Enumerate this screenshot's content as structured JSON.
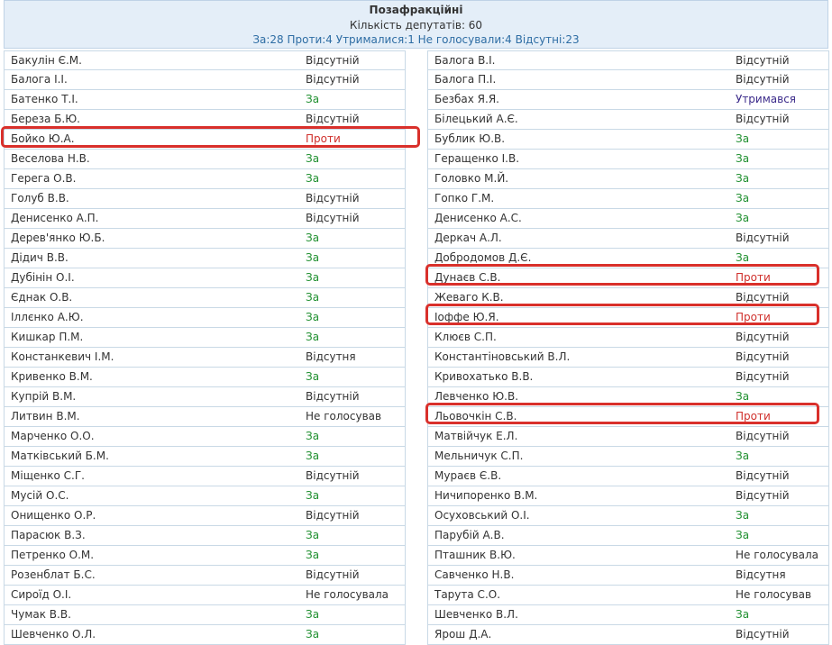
{
  "header": {
    "title": "Позафракційні",
    "count": "Кількість депутатів: 60",
    "summary": "За:28 Проти:4 Утрималися:1 Не голосували:4 Відсутні:23"
  },
  "colors": {
    "za": "#1f8f2f",
    "against": "#d0312d",
    "abstain": "#3b2a8a",
    "highlight": "#d9302b"
  },
  "left": [
    {
      "name": "Бакулін Є.М.",
      "vote": "Відсутній",
      "t": "absent"
    },
    {
      "name": "Балога І.І.",
      "vote": "Відсутній",
      "t": "absent"
    },
    {
      "name": "Батенко Т.І.",
      "vote": "За",
      "t": "za"
    },
    {
      "name": "Береза Б.Ю.",
      "vote": "Відсутній",
      "t": "absent"
    },
    {
      "name": "Бойко Ю.А.",
      "vote": "Проти",
      "t": "against",
      "hl": true
    },
    {
      "name": "Веселова Н.В.",
      "vote": "За",
      "t": "za"
    },
    {
      "name": "Герега О.В.",
      "vote": "За",
      "t": "za"
    },
    {
      "name": "Голуб В.В.",
      "vote": "Відсутній",
      "t": "absent"
    },
    {
      "name": "Денисенко А.П.",
      "vote": "Відсутній",
      "t": "absent"
    },
    {
      "name": "Дерев'янко Ю.Б.",
      "vote": "За",
      "t": "za"
    },
    {
      "name": "Дідич В.В.",
      "vote": "За",
      "t": "za"
    },
    {
      "name": "Дубінін О.І.",
      "vote": "За",
      "t": "za"
    },
    {
      "name": "Єднак О.В.",
      "vote": "За",
      "t": "za"
    },
    {
      "name": "Іллєнко А.Ю.",
      "vote": "За",
      "t": "za"
    },
    {
      "name": "Кишкар П.М.",
      "vote": "За",
      "t": "za"
    },
    {
      "name": "Констанкевич І.М.",
      "vote": "Відсутня",
      "t": "absent"
    },
    {
      "name": "Кривенко В.М.",
      "vote": "За",
      "t": "za"
    },
    {
      "name": "Купрій В.М.",
      "vote": "Відсутній",
      "t": "absent"
    },
    {
      "name": "Литвин В.М.",
      "vote": "Не голосував",
      "t": "nv"
    },
    {
      "name": "Марченко О.О.",
      "vote": "За",
      "t": "za"
    },
    {
      "name": "Матківський Б.М.",
      "vote": "За",
      "t": "za"
    },
    {
      "name": "Міщенко С.Г.",
      "vote": "Відсутній",
      "t": "absent"
    },
    {
      "name": "Мусій О.С.",
      "vote": "За",
      "t": "za"
    },
    {
      "name": "Онищенко О.Р.",
      "vote": "Відсутній",
      "t": "absent"
    },
    {
      "name": "Парасюк В.З.",
      "vote": "За",
      "t": "za"
    },
    {
      "name": "Петренко О.М.",
      "vote": "За",
      "t": "za"
    },
    {
      "name": "Розенблат Б.С.",
      "vote": "Відсутній",
      "t": "absent"
    },
    {
      "name": "Сироїд О.І.",
      "vote": "Не голосувала",
      "t": "nv"
    },
    {
      "name": "Чумак В.В.",
      "vote": "За",
      "t": "za"
    },
    {
      "name": "Шевченко О.Л.",
      "vote": "За",
      "t": "za"
    }
  ],
  "right": [
    {
      "name": "Балога В.І.",
      "vote": "Відсутній",
      "t": "absent"
    },
    {
      "name": "Балога П.І.",
      "vote": "Відсутній",
      "t": "absent"
    },
    {
      "name": "Безбах Я.Я.",
      "vote": "Утримався",
      "t": "abstain"
    },
    {
      "name": "Білецький А.Є.",
      "vote": "Відсутній",
      "t": "absent"
    },
    {
      "name": "Бублик Ю.В.",
      "vote": "За",
      "t": "za"
    },
    {
      "name": "Геращенко І.В.",
      "vote": "За",
      "t": "za"
    },
    {
      "name": "Головко М.Й.",
      "vote": "За",
      "t": "za"
    },
    {
      "name": "Гопко Г.М.",
      "vote": "За",
      "t": "za"
    },
    {
      "name": "Денисенко А.С.",
      "vote": "За",
      "t": "za"
    },
    {
      "name": "Деркач А.Л.",
      "vote": "Відсутній",
      "t": "absent"
    },
    {
      "name": "Добродомов Д.Є.",
      "vote": "За",
      "t": "za"
    },
    {
      "name": "Дунаєв С.В.",
      "vote": "Проти",
      "t": "against",
      "hl": true
    },
    {
      "name": "Жеваго К.В.",
      "vote": "Відсутній",
      "t": "absent"
    },
    {
      "name": "Іоффе Ю.Я.",
      "vote": "Проти",
      "t": "against",
      "hl": true
    },
    {
      "name": "Клюєв С.П.",
      "vote": "Відсутній",
      "t": "absent"
    },
    {
      "name": "Константіновський В.Л.",
      "vote": "Відсутній",
      "t": "absent"
    },
    {
      "name": "Кривохатько В.В.",
      "vote": "Відсутній",
      "t": "absent"
    },
    {
      "name": "Левченко Ю.В.",
      "vote": "За",
      "t": "za"
    },
    {
      "name": "Льовочкін С.В.",
      "vote": "Проти",
      "t": "against",
      "hl": true
    },
    {
      "name": "Матвійчук Е.Л.",
      "vote": "Відсутній",
      "t": "absent"
    },
    {
      "name": "Мельничук С.П.",
      "vote": "За",
      "t": "za"
    },
    {
      "name": "Мураєв Є.В.",
      "vote": "Відсутній",
      "t": "absent"
    },
    {
      "name": "Ничипоренко В.М.",
      "vote": "Відсутній",
      "t": "absent"
    },
    {
      "name": "Осуховський О.І.",
      "vote": "За",
      "t": "za"
    },
    {
      "name": "Парубій А.В.",
      "vote": "За",
      "t": "za"
    },
    {
      "name": "Пташник В.Ю.",
      "vote": "Не голосувала",
      "t": "nv"
    },
    {
      "name": "Савченко Н.В.",
      "vote": "Відсутня",
      "t": "absent"
    },
    {
      "name": "Тарута С.О.",
      "vote": "Не голосував",
      "t": "nv"
    },
    {
      "name": "Шевченко В.Л.",
      "vote": "За",
      "t": "za"
    },
    {
      "name": "Ярош Д.А.",
      "vote": "Відсутній",
      "t": "absent"
    }
  ]
}
